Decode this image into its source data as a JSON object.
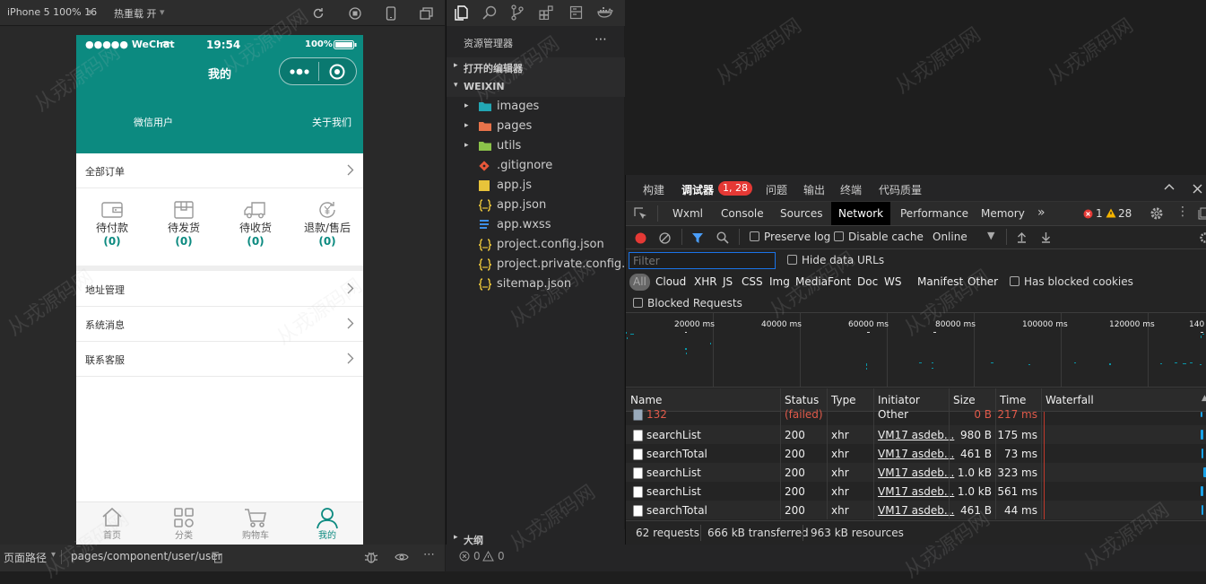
{
  "simulator": {
    "device": "iPhone 5 100% 16",
    "hot_reload": "热重载 开"
  },
  "phone": {
    "status": {
      "carrier": "●●●●● WeChat",
      "time": "19:54",
      "battery": "100%"
    },
    "title": "我的",
    "user_name": "微信用户",
    "about": "关于我们",
    "all_orders": "全部订单",
    "orders": [
      {
        "label": "待付款",
        "count": "(0)"
      },
      {
        "label": "待发货",
        "count": "(0)"
      },
      {
        "label": "待收货",
        "count": "(0)"
      },
      {
        "label": "退款/售后",
        "count": "(0)"
      }
    ],
    "menu": [
      "地址管理",
      "系统消息",
      "联系客服"
    ],
    "tabs": [
      "首页",
      "分类",
      "购物车",
      "我的"
    ]
  },
  "bottom": {
    "path_label": "页面路径",
    "path": "pages/component/user/user",
    "errors": "0",
    "warnings": "0"
  },
  "explorer": {
    "title": "资源管理器",
    "open_editors": "打开的编辑器",
    "project": "WEIXIN",
    "outline": "大纲",
    "folders": [
      {
        "name": "images",
        "color": "#22a6b3"
      },
      {
        "name": "pages",
        "color": "#e8734a"
      },
      {
        "name": "utils",
        "color": "#8bc34a"
      }
    ],
    "files": [
      {
        "name": ".gitignore",
        "icon": "git-icon"
      },
      {
        "name": "app.js",
        "icon": "js-icon"
      },
      {
        "name": "app.json",
        "icon": "json-icon"
      },
      {
        "name": "app.wxss",
        "icon": "css-icon"
      },
      {
        "name": "project.config.json",
        "icon": "json-icon"
      },
      {
        "name": "project.private.config.js...",
        "icon": "json-icon"
      },
      {
        "name": "sitemap.json",
        "icon": "json-icon"
      }
    ]
  },
  "devtools": {
    "top_tabs": [
      "构建",
      "调试器",
      "问题",
      "输出",
      "终端",
      "代码质量"
    ],
    "badge": "1, 28",
    "panel_tabs": [
      "Wxml",
      "Console",
      "Sources",
      "Network",
      "Performance",
      "Memory"
    ],
    "error_count": "1",
    "warning_count": "28",
    "preserve_log": "Preserve log",
    "disable_cache": "Disable cache",
    "throttle": "Online",
    "filter_placeholder": "Filter",
    "hide_data_urls": "Hide data URLs",
    "types": [
      "All",
      "Cloud",
      "XHR",
      "JS",
      "CSS",
      "Img",
      "Media",
      "Font",
      "Doc",
      "WS",
      "Manifest",
      "Other"
    ],
    "has_blocked_cookies": "Has blocked cookies",
    "blocked_requests": "Blocked Requests",
    "timeline": [
      "20000 ms",
      "40000 ms",
      "60000 ms",
      "80000 ms",
      "100000 ms",
      "120000 ms",
      "140"
    ],
    "columns": [
      "Name",
      "Status",
      "Type",
      "Initiator",
      "Size",
      "Time",
      "Waterfall"
    ],
    "rows": [
      {
        "name": "132",
        "status": "(failed)",
        "type": "",
        "initiator": "Other",
        "size": "0 B",
        "time": "217 ms",
        "failed": true
      },
      {
        "name": "searchList",
        "status": "200",
        "type": "xhr",
        "initiator": "VM17 asdeb...",
        "size": "980 B",
        "time": "175 ms"
      },
      {
        "name": "searchTotal",
        "status": "200",
        "type": "xhr",
        "initiator": "VM17 asdeb...",
        "size": "461 B",
        "time": "73 ms"
      },
      {
        "name": "searchList",
        "status": "200",
        "type": "xhr",
        "initiator": "VM17 asdeb...",
        "size": "1.0 kB",
        "time": "323 ms"
      },
      {
        "name": "searchList",
        "status": "200",
        "type": "xhr",
        "initiator": "VM17 asdeb...",
        "size": "1.0 kB",
        "time": "561 ms"
      },
      {
        "name": "searchTotal",
        "status": "200",
        "type": "xhr",
        "initiator": "VM17 asdeb...",
        "size": "461 B",
        "time": "44 ms"
      }
    ],
    "summary": {
      "requests": "62 requests",
      "transferred": "666 kB transferred",
      "resources": "963 kB resources"
    }
  },
  "watermark": "从戎源码网",
  "colors": {
    "brand": "#0c8a80",
    "accent_red": "#e53935",
    "selected_tab": "#000000"
  }
}
